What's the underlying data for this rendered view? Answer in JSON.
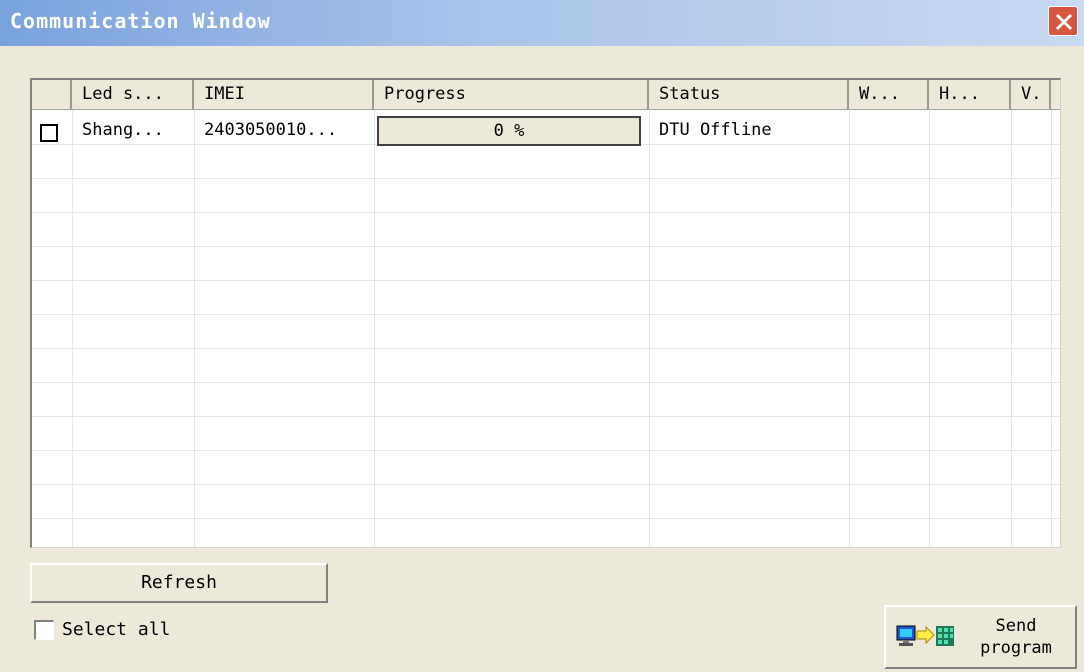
{
  "window": {
    "title": "Communication Window"
  },
  "list": {
    "columns": [
      "",
      "Led s...",
      "IMEI",
      "Progress",
      "Status",
      "W...",
      "H...",
      "V."
    ],
    "rows": [
      {
        "checked": false,
        "led_screen": "Shang...",
        "imei": "2403050010...",
        "progress": "0 %",
        "progress_value": 0,
        "status": "DTU Offline",
        "w": "",
        "h": "",
        "v": ""
      }
    ]
  },
  "buttons": {
    "refresh": "Refresh",
    "select_all": "Select all",
    "send_line1": "Send",
    "send_line2": "program"
  },
  "icons": {
    "close": "close-icon",
    "send": "computer-arrow-icon",
    "select": "checkbox-icon"
  },
  "colors": {
    "titlebar_start": "#7aa3dc",
    "titlebar_end": "#c9daf3",
    "close_button": "#d6573f",
    "face": "#ece9d8"
  }
}
